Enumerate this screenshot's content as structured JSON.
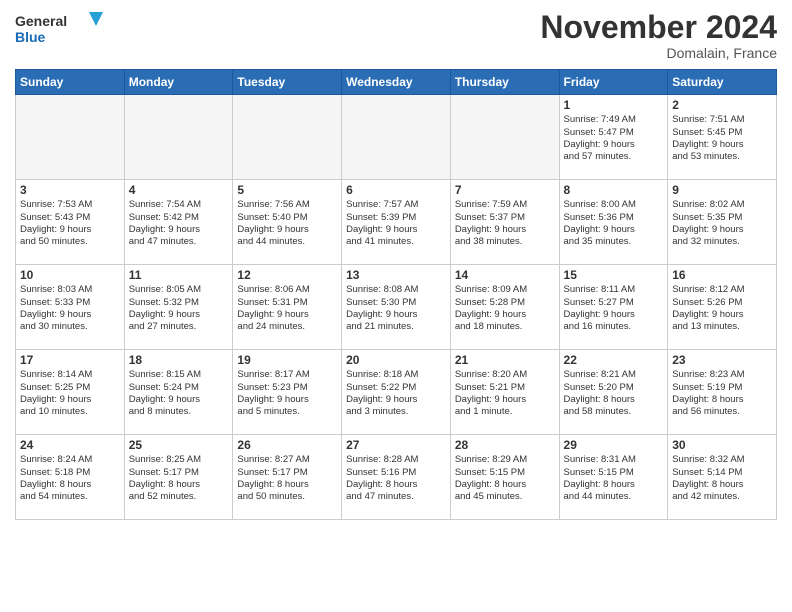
{
  "header": {
    "logo_general": "General",
    "logo_blue": "Blue",
    "month_title": "November 2024",
    "location": "Domalain, France"
  },
  "days_of_week": [
    "Sunday",
    "Monday",
    "Tuesday",
    "Wednesday",
    "Thursday",
    "Friday",
    "Saturday"
  ],
  "weeks": [
    [
      {
        "day": "",
        "info": ""
      },
      {
        "day": "",
        "info": ""
      },
      {
        "day": "",
        "info": ""
      },
      {
        "day": "",
        "info": ""
      },
      {
        "day": "",
        "info": ""
      },
      {
        "day": "1",
        "info": "Sunrise: 7:49 AM\nSunset: 5:47 PM\nDaylight: 9 hours\nand 57 minutes."
      },
      {
        "day": "2",
        "info": "Sunrise: 7:51 AM\nSunset: 5:45 PM\nDaylight: 9 hours\nand 53 minutes."
      }
    ],
    [
      {
        "day": "3",
        "info": "Sunrise: 7:53 AM\nSunset: 5:43 PM\nDaylight: 9 hours\nand 50 minutes."
      },
      {
        "day": "4",
        "info": "Sunrise: 7:54 AM\nSunset: 5:42 PM\nDaylight: 9 hours\nand 47 minutes."
      },
      {
        "day": "5",
        "info": "Sunrise: 7:56 AM\nSunset: 5:40 PM\nDaylight: 9 hours\nand 44 minutes."
      },
      {
        "day": "6",
        "info": "Sunrise: 7:57 AM\nSunset: 5:39 PM\nDaylight: 9 hours\nand 41 minutes."
      },
      {
        "day": "7",
        "info": "Sunrise: 7:59 AM\nSunset: 5:37 PM\nDaylight: 9 hours\nand 38 minutes."
      },
      {
        "day": "8",
        "info": "Sunrise: 8:00 AM\nSunset: 5:36 PM\nDaylight: 9 hours\nand 35 minutes."
      },
      {
        "day": "9",
        "info": "Sunrise: 8:02 AM\nSunset: 5:35 PM\nDaylight: 9 hours\nand 32 minutes."
      }
    ],
    [
      {
        "day": "10",
        "info": "Sunrise: 8:03 AM\nSunset: 5:33 PM\nDaylight: 9 hours\nand 30 minutes."
      },
      {
        "day": "11",
        "info": "Sunrise: 8:05 AM\nSunset: 5:32 PM\nDaylight: 9 hours\nand 27 minutes."
      },
      {
        "day": "12",
        "info": "Sunrise: 8:06 AM\nSunset: 5:31 PM\nDaylight: 9 hours\nand 24 minutes."
      },
      {
        "day": "13",
        "info": "Sunrise: 8:08 AM\nSunset: 5:30 PM\nDaylight: 9 hours\nand 21 minutes."
      },
      {
        "day": "14",
        "info": "Sunrise: 8:09 AM\nSunset: 5:28 PM\nDaylight: 9 hours\nand 18 minutes."
      },
      {
        "day": "15",
        "info": "Sunrise: 8:11 AM\nSunset: 5:27 PM\nDaylight: 9 hours\nand 16 minutes."
      },
      {
        "day": "16",
        "info": "Sunrise: 8:12 AM\nSunset: 5:26 PM\nDaylight: 9 hours\nand 13 minutes."
      }
    ],
    [
      {
        "day": "17",
        "info": "Sunrise: 8:14 AM\nSunset: 5:25 PM\nDaylight: 9 hours\nand 10 minutes."
      },
      {
        "day": "18",
        "info": "Sunrise: 8:15 AM\nSunset: 5:24 PM\nDaylight: 9 hours\nand 8 minutes."
      },
      {
        "day": "19",
        "info": "Sunrise: 8:17 AM\nSunset: 5:23 PM\nDaylight: 9 hours\nand 5 minutes."
      },
      {
        "day": "20",
        "info": "Sunrise: 8:18 AM\nSunset: 5:22 PM\nDaylight: 9 hours\nand 3 minutes."
      },
      {
        "day": "21",
        "info": "Sunrise: 8:20 AM\nSunset: 5:21 PM\nDaylight: 9 hours\nand 1 minute."
      },
      {
        "day": "22",
        "info": "Sunrise: 8:21 AM\nSunset: 5:20 PM\nDaylight: 8 hours\nand 58 minutes."
      },
      {
        "day": "23",
        "info": "Sunrise: 8:23 AM\nSunset: 5:19 PM\nDaylight: 8 hours\nand 56 minutes."
      }
    ],
    [
      {
        "day": "24",
        "info": "Sunrise: 8:24 AM\nSunset: 5:18 PM\nDaylight: 8 hours\nand 54 minutes."
      },
      {
        "day": "25",
        "info": "Sunrise: 8:25 AM\nSunset: 5:17 PM\nDaylight: 8 hours\nand 52 minutes."
      },
      {
        "day": "26",
        "info": "Sunrise: 8:27 AM\nSunset: 5:17 PM\nDaylight: 8 hours\nand 50 minutes."
      },
      {
        "day": "27",
        "info": "Sunrise: 8:28 AM\nSunset: 5:16 PM\nDaylight: 8 hours\nand 47 minutes."
      },
      {
        "day": "28",
        "info": "Sunrise: 8:29 AM\nSunset: 5:15 PM\nDaylight: 8 hours\nand 45 minutes."
      },
      {
        "day": "29",
        "info": "Sunrise: 8:31 AM\nSunset: 5:15 PM\nDaylight: 8 hours\nand 44 minutes."
      },
      {
        "day": "30",
        "info": "Sunrise: 8:32 AM\nSunset: 5:14 PM\nDaylight: 8 hours\nand 42 minutes."
      }
    ]
  ]
}
